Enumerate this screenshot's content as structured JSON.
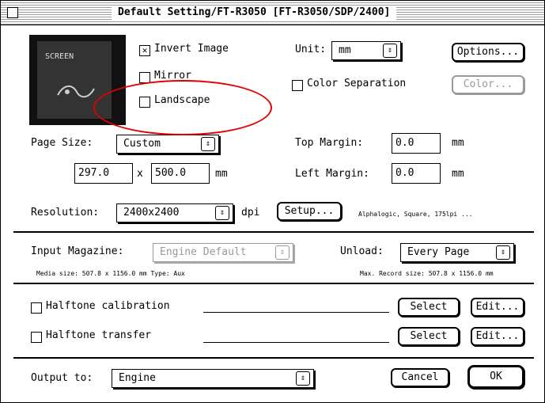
{
  "window": {
    "title": "Default Setting/FT-R3050 [FT-R3050/SDP/2400]"
  },
  "preview": {
    "label": "SCREEN"
  },
  "checks": {
    "invert": {
      "label": "Invert Image",
      "checked": true
    },
    "mirror": {
      "label": "Mirror",
      "checked": false
    },
    "landscape": {
      "label": "Landscape",
      "checked": false
    },
    "color_sep": {
      "label": "Color Separation",
      "checked": false
    }
  },
  "unit": {
    "label": "Unit:",
    "value": "mm"
  },
  "buttons": {
    "options": "Options...",
    "color": "Color...",
    "setup": "Setup...",
    "select1": "Select",
    "edit1": "Edit...",
    "select2": "Select",
    "edit2": "Edit...",
    "cancel": "Cancel",
    "ok": "OK"
  },
  "page_size": {
    "label": "Page Size:",
    "value": "Custom",
    "width": "297.0",
    "x": "x",
    "height": "500.0",
    "unit": "mm"
  },
  "margins": {
    "top_label": "Top Margin:",
    "top_value": "0.0",
    "top_unit": "mm",
    "left_label": "Left Margin:",
    "left_value": "0.0",
    "left_unit": "mm"
  },
  "resolution": {
    "label": "Resolution:",
    "value": "2400x2400",
    "unit": "dpi",
    "info": "Alphalogic, Square, 175lpi ..."
  },
  "input": {
    "label": "Input Magazine:",
    "value": "Engine Default",
    "media": "Media size: 507.8 x 1156.0 mm  Type: Aux"
  },
  "unload": {
    "label": "Unload:",
    "value": "Every Page",
    "max_record": "Max. Record size: 507.8 x 1156.0 mm"
  },
  "halftone": {
    "calibration": "Halftone calibration",
    "transfer": "Halftone transfer"
  },
  "output": {
    "label": "Output to:",
    "value": "Engine"
  },
  "annotation": {
    "color": "#e00000"
  }
}
